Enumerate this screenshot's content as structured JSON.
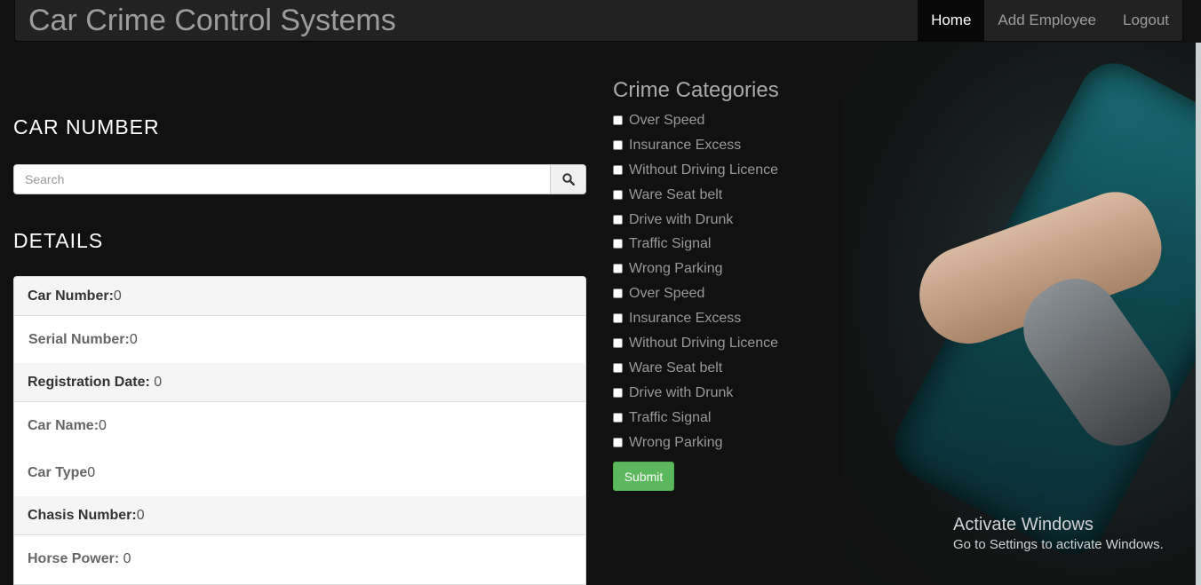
{
  "navbar": {
    "brand": "Car Crime Control Systems",
    "links": [
      {
        "label": "Home",
        "active": true
      },
      {
        "label": "Add Employee",
        "active": false
      },
      {
        "label": "Logout",
        "active": false
      }
    ]
  },
  "search": {
    "heading": "CAR NUMBER",
    "placeholder": "Search",
    "button_icon": "search-icon"
  },
  "details": {
    "heading": "DETAILS",
    "rows": [
      {
        "label": "Car Number:",
        "value": "0"
      },
      {
        "label": "Serial Number:",
        "value": "0"
      },
      {
        "label": "Registration Date:",
        "value": " 0"
      },
      {
        "label": "Car Name:",
        "value": "0"
      },
      {
        "label": "Car Type",
        "value": "0"
      },
      {
        "label": "Chasis Number:",
        "value": "0"
      },
      {
        "label": "Horse Power:",
        "value": " 0"
      }
    ]
  },
  "crime": {
    "heading": "Crime Categories",
    "items": [
      "Over Speed",
      "Insurance Excess",
      "Without Driving Licence",
      "Ware Seat belt",
      "Drive with Drunk",
      "Traffic Signal",
      "Wrong Parking",
      "Over Speed",
      "Insurance Excess",
      "Without Driving Licence",
      "Ware Seat belt",
      "Drive with Drunk",
      "Traffic Signal",
      "Wrong Parking"
    ],
    "submit_label": "Submit"
  },
  "watermark": {
    "title": "Activate Windows",
    "subtitle": "Go to Settings to activate Windows."
  },
  "colors": {
    "navbar_bg": "#222222",
    "submit_green": "#5cb85c",
    "page_bg": "#111111"
  }
}
